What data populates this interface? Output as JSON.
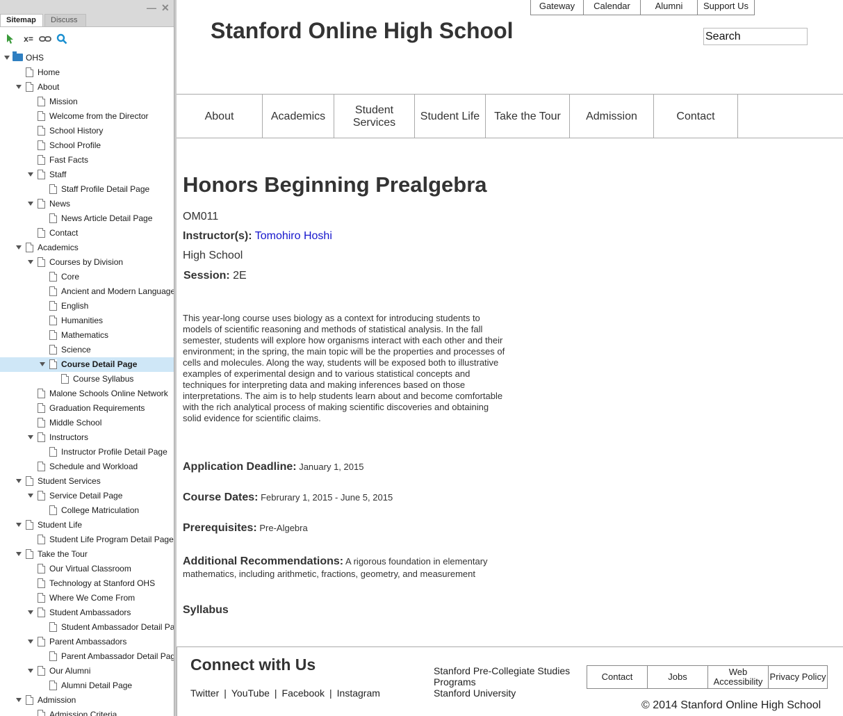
{
  "panel": {
    "tabs": [
      "Sitemap",
      "Discuss"
    ],
    "toolbar": {
      "filter_text": "x="
    },
    "tree": [
      {
        "label": "OHS",
        "level": 0,
        "type": "folder",
        "expanded": true
      },
      {
        "label": "Home",
        "level": 1,
        "type": "page"
      },
      {
        "label": "About",
        "level": 1,
        "type": "page",
        "expanded": true
      },
      {
        "label": "Mission",
        "level": 2,
        "type": "page"
      },
      {
        "label": "Welcome from the Director",
        "level": 2,
        "type": "page"
      },
      {
        "label": "School History",
        "level": 2,
        "type": "page"
      },
      {
        "label": "School Profile",
        "level": 2,
        "type": "page"
      },
      {
        "label": "Fast Facts",
        "level": 2,
        "type": "page"
      },
      {
        "label": "Staff",
        "level": 2,
        "type": "page",
        "expanded": true
      },
      {
        "label": "Staff Profile Detail Page",
        "level": 3,
        "type": "page"
      },
      {
        "label": "News",
        "level": 2,
        "type": "page",
        "expanded": true
      },
      {
        "label": "News Article Detail Page",
        "level": 3,
        "type": "page"
      },
      {
        "label": "Contact",
        "level": 2,
        "type": "page"
      },
      {
        "label": "Academics",
        "level": 1,
        "type": "page",
        "expanded": true
      },
      {
        "label": "Courses by Division",
        "level": 2,
        "type": "page",
        "expanded": true
      },
      {
        "label": "Core",
        "level": 3,
        "type": "page"
      },
      {
        "label": "Ancient and Modern Languages",
        "level": 3,
        "type": "page"
      },
      {
        "label": "English",
        "level": 3,
        "type": "page"
      },
      {
        "label": "Humanities",
        "level": 3,
        "type": "page"
      },
      {
        "label": "Mathematics",
        "level": 3,
        "type": "page"
      },
      {
        "label": "Science",
        "level": 3,
        "type": "page"
      },
      {
        "label": "Course Detail Page",
        "level": 3,
        "type": "page",
        "expanded": true,
        "selected": true
      },
      {
        "label": "Course Syllabus",
        "level": 4,
        "type": "page"
      },
      {
        "label": "Malone Schools Online Network",
        "level": 2,
        "type": "page"
      },
      {
        "label": "Graduation Requirements",
        "level": 2,
        "type": "page"
      },
      {
        "label": "Middle School",
        "level": 2,
        "type": "page"
      },
      {
        "label": "Instructors",
        "level": 2,
        "type": "page",
        "expanded": true
      },
      {
        "label": "Instructor Profile Detail Page",
        "level": 3,
        "type": "page"
      },
      {
        "label": "Schedule and Workload",
        "level": 2,
        "type": "page"
      },
      {
        "label": "Student Services",
        "level": 1,
        "type": "page",
        "expanded": true
      },
      {
        "label": "Service Detail Page",
        "level": 2,
        "type": "page",
        "expanded": true
      },
      {
        "label": "College Matriculation",
        "level": 3,
        "type": "page"
      },
      {
        "label": "Student Life",
        "level": 1,
        "type": "page",
        "expanded": true
      },
      {
        "label": "Student Life Program Detail Page",
        "level": 2,
        "type": "page"
      },
      {
        "label": "Take the Tour",
        "level": 1,
        "type": "page",
        "expanded": true
      },
      {
        "label": "Our Virtual Classroom",
        "level": 2,
        "type": "page"
      },
      {
        "label": "Technology at Stanford OHS",
        "level": 2,
        "type": "page"
      },
      {
        "label": "Where We Come From",
        "level": 2,
        "type": "page"
      },
      {
        "label": "Student Ambassadors",
        "level": 2,
        "type": "page",
        "expanded": true
      },
      {
        "label": "Student Ambassador Detail Page",
        "level": 3,
        "type": "page"
      },
      {
        "label": "Parent Ambassadors",
        "level": 2,
        "type": "page",
        "expanded": true
      },
      {
        "label": "Parent Ambassador Detail Page",
        "level": 3,
        "type": "page"
      },
      {
        "label": "Our Alumni",
        "level": 2,
        "type": "page",
        "expanded": true
      },
      {
        "label": "Alumni Detail Page",
        "level": 3,
        "type": "page"
      },
      {
        "label": "Admission",
        "level": 1,
        "type": "page",
        "expanded": true
      },
      {
        "label": "Admission Criteria",
        "level": 2,
        "type": "page"
      }
    ]
  },
  "site": {
    "utility_nav": [
      "Gateway",
      "Calendar",
      "Alumni",
      "Support Us"
    ],
    "school_name": "Stanford Online High School",
    "search": {
      "value": "",
      "placeholder": "Search"
    },
    "main_nav": [
      "About",
      "Academics",
      "Student Services",
      "Student Life",
      "Take the Tour",
      "Admission",
      "Contact"
    ],
    "course": {
      "title": "Honors Beginning Prealgebra",
      "code": "OM011",
      "instructor_label": "Instructor(s):",
      "instructor_name": "Tomohiro Hoshi",
      "division": "High School",
      "session_label": "Session:",
      "session_value": "2E",
      "description": "This year-long course uses biology as a context for introducing students to models of scientific reasoning and methods of statistical analysis. In the fall semester, students will explore how organisms interact with each other and their environment; in the spring, the main topic will be the properties and processes of cells and molecules. Along the way, students will be exposed both to illustrative examples of experimental design and to various statistical concepts and techniques for interpreting data and making inferences based on those interpretations. The aim is to help students learn about and become comfortable with the rich analytical process of making scientific discoveries and obtaining solid evidence for scientific claims.",
      "deadline_label": "Application Deadline:",
      "deadline_value": "January 1, 2015",
      "dates_label": "Course Dates:",
      "dates_value": "Februrary 1, 2015 - June 5, 2015",
      "prereq_label": "Prerequisites:",
      "prereq_value": "Pre-Algebra",
      "recs_label": "Additional Recommendations:",
      "recs_value": "A rigorous foundation in elementary mathematics, including arithmetic, fractions, geometry, and measurement",
      "syllabus_label": "Syllabus"
    },
    "footer": {
      "connect_heading": "Connect with Us",
      "social": [
        "Twitter",
        "YouTube",
        "Facebook",
        "Instagram"
      ],
      "address": [
        "Stanford Pre-Collegiate Studies",
        "Programs",
        "Stanford University"
      ],
      "links": [
        "Contact",
        "Jobs",
        "Web Accessibility",
        "Privacy Policy"
      ],
      "copyright": "© 2014 Stanford Online High School"
    }
  }
}
